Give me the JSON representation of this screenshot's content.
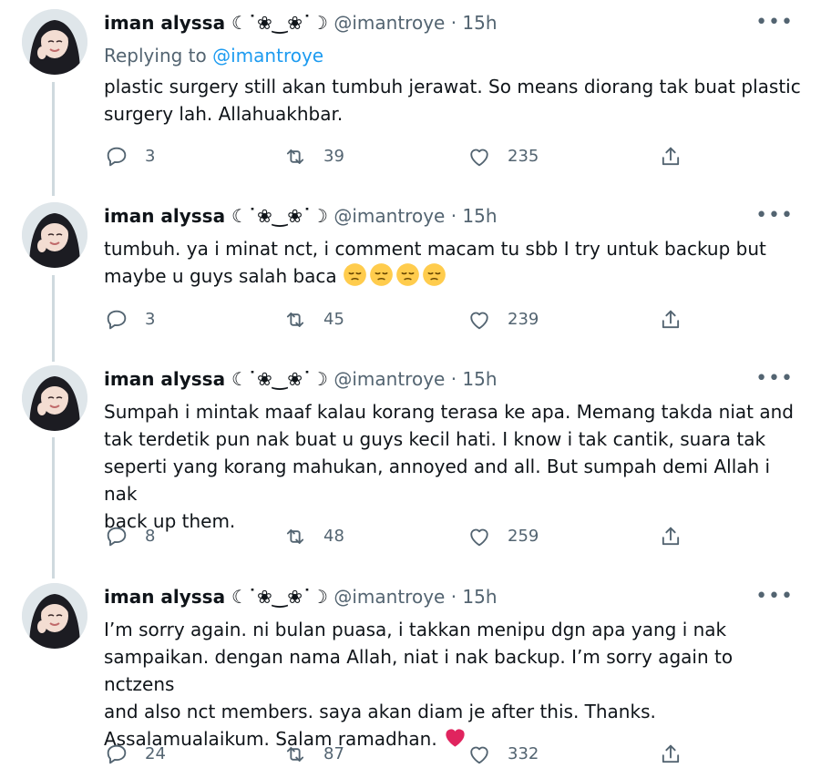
{
  "tweets": [
    {
      "name": "iman alyssa ☾˙❀‿❀˙☽",
      "handle": "@imantroye",
      "time": "15h",
      "more_label": "•••",
      "replying_prefix": "Replying to ",
      "replying_user": "@imantroye",
      "lines": [
        "plastic surgery still akan tumbuh jerawat. So means diorang tak buat plastic",
        "surgery lah. Allahuakhbar."
      ],
      "replies": "3",
      "retweets": "39",
      "likes": "235"
    },
    {
      "name": "iman alyssa ☾˙❀‿❀˙☽",
      "handle": "@imantroye",
      "time": "15h",
      "more_label": "•••",
      "lines": [
        "tumbuh. ya i minat nct, i comment macam tu sbb I try untuk backup but",
        "maybe u guys salah baca"
      ],
      "emoji": [
        "pensive-face-emoji",
        "pensive-face-emoji",
        "pensive-face-emoji",
        "pensive-face-emoji"
      ],
      "replies": "3",
      "retweets": "45",
      "likes": "239"
    },
    {
      "name": "iman alyssa ☾˙❀‿❀˙☽",
      "handle": "@imantroye",
      "time": "15h",
      "more_label": "•••",
      "lines": [
        "Sumpah i mintak maaf kalau korang terasa ke apa. Memang takda niat and",
        "tak terdetik pun nak buat u guys kecil hati. I know i tak cantik, suara tak",
        "seperti yang korang mahukan, annoyed and all. But sumpah demi Allah i nak",
        "back up them."
      ],
      "replies": "8",
      "retweets": "48",
      "likes": "259"
    },
    {
      "name": "iman alyssa ☾˙❀‿❀˙☽",
      "handle": "@imantroye",
      "time": "15h",
      "more_label": "•••",
      "lines": [
        "I’m sorry again. ni bulan puasa, i takkan menipu dgn apa yang i nak",
        "sampaikan. dengan nama Allah, niat i nak backup. I’m sorry again to nctzens",
        "and also nct members. saya akan diam je after this. Thanks.",
        "Assalamualaikum. Salam ramadhan."
      ],
      "emoji": [
        "red-heart-emoji"
      ],
      "replies": "24",
      "retweets": "87",
      "likes": "332"
    }
  ],
  "colors": {
    "text": "#0f1419",
    "secondary": "#536471",
    "link": "#1d9bf0",
    "thread_line": "#cfd9de",
    "heart": "#e0245e"
  }
}
